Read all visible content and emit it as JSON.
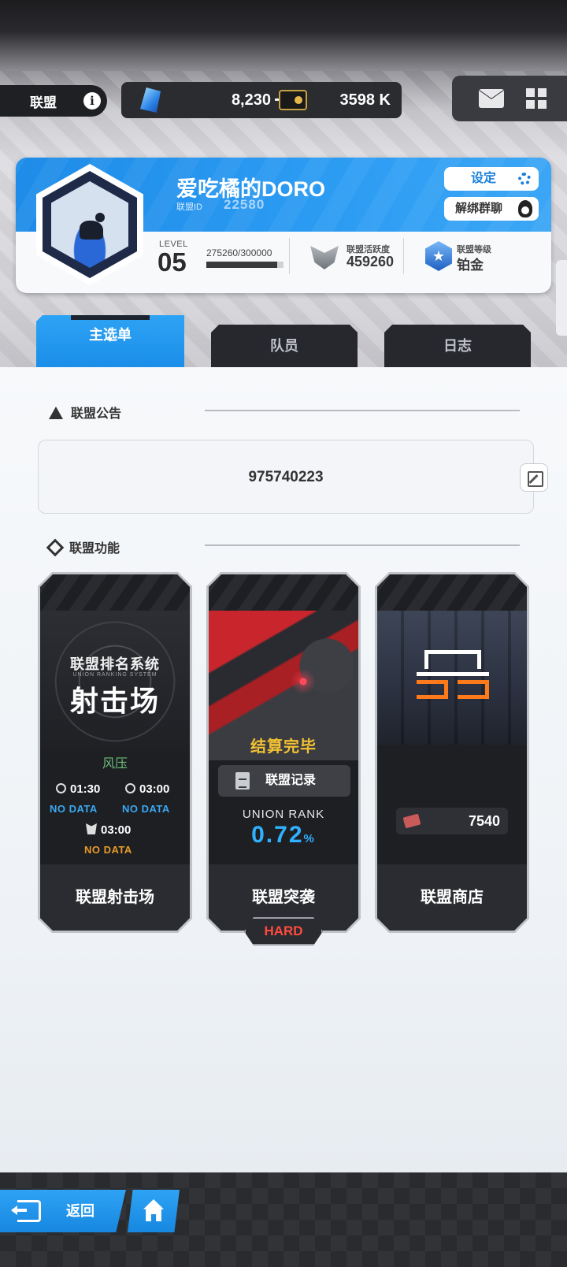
{
  "topbar": {
    "title": "联盟",
    "info_icon": "info-icon",
    "gems": "8,230",
    "gems_plus": "+",
    "credits": "3598 K",
    "mail_icon": "mail-icon",
    "menu_icon": "grid-icon"
  },
  "union": {
    "name": "爱吃橘的DORO",
    "id_label": "联盟ID",
    "id": "22580",
    "setting_label": "设定",
    "unbind_label": "解绑群聊",
    "level_label": "LEVEL",
    "level": "05",
    "exp_text": "275260/300000",
    "exp_progress": 0.9175,
    "activity_label": "联盟活跃度",
    "activity": "459260",
    "rank_label": "联盟等级",
    "rank": "铂金",
    "colors": {
      "accent": "#1e8ce8",
      "bg": "#f8f9fb"
    }
  },
  "tabs": [
    {
      "label": "主选单",
      "active": true,
      "arrow": "▼"
    },
    {
      "label": "队员",
      "active": false
    },
    {
      "label": "日志",
      "active": false
    }
  ],
  "notice": {
    "title": "联盟公告",
    "text": "975740223"
  },
  "functions": {
    "title": "联盟功能",
    "cards": [
      {
        "footer": "联盟射击场",
        "system_title": "联盟排名系统",
        "system_sub": "UNION RANKING SYSTEM",
        "big_title": "射击场",
        "wind": "风压",
        "time1": "01:30",
        "time2": "03:00",
        "nodata1": "NO DATA",
        "nodata2": "NO DATA",
        "time3": "03:00",
        "nodata3": "NO DATA"
      },
      {
        "footer": "联盟突袭",
        "status": "结算完毕",
        "record_label": "联盟记录",
        "rank_label": "UNION RANK",
        "rank_value": "0.72",
        "rank_unit": "%",
        "difficulty": "HARD"
      },
      {
        "footer": "联盟商店",
        "currency": "7540"
      }
    ]
  },
  "bottom": {
    "back_label": "返回",
    "home_icon": "home-icon"
  }
}
